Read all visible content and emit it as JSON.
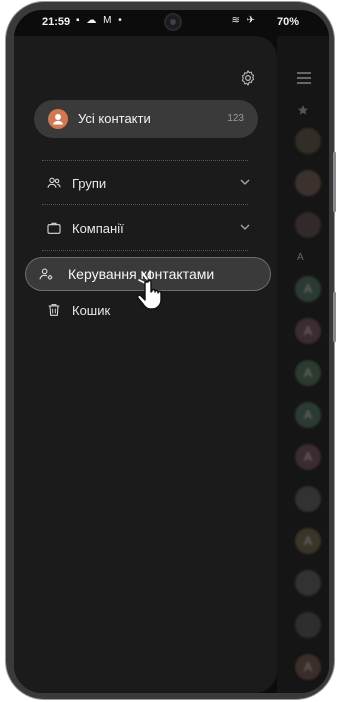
{
  "status_bar": {
    "time": "21:59",
    "left_icons": "▪ ☁ M •",
    "right_icons": "≋ ✈",
    "battery": "70%"
  },
  "drawer": {
    "all_contacts": {
      "label": "Усі контакти",
      "count": "123"
    },
    "items": [
      {
        "label": "Групи",
        "icon": "people-icon",
        "expandable": true
      },
      {
        "label": "Компанії",
        "icon": "briefcase-icon",
        "expandable": true
      },
      {
        "label": "Керування контактами",
        "icon": "manage-contacts-icon",
        "highlighted": true
      },
      {
        "label": "Кошик",
        "icon": "trash-icon"
      }
    ]
  },
  "background_list": {
    "header_letter": "A",
    "avatar_letter": "A"
  },
  "colors": {
    "drawer_bg": "#1b1b1b",
    "pill_bg": "#3a3a3a",
    "avatar_orange": "#d4774e"
  }
}
